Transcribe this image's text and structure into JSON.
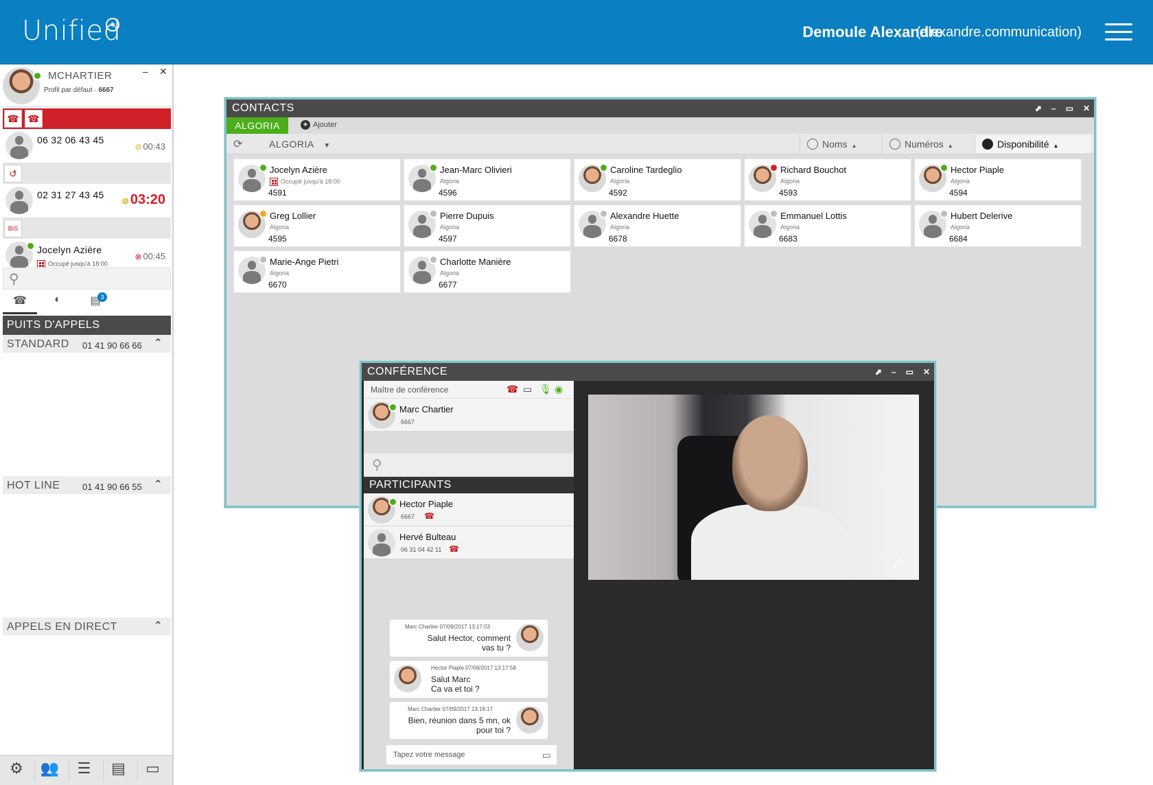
{
  "header": {
    "logo": "Unified",
    "user_name": "Demoule Alexandre",
    "user_id": "(alexandre.communication)"
  },
  "profile": {
    "name": "MCHARTIER",
    "profile_label": "Profil par défaut · ",
    "extension": "6667"
  },
  "calls": [
    {
      "number": "06 32 06 43 45",
      "timer": "00:43"
    },
    {
      "number": "02 31 27 43 45",
      "timer": "03:20"
    },
    {
      "number": "Jocelyn Azière",
      "status": "Occupé jusqu'à 18:00",
      "timer": "00:45"
    }
  ],
  "tabs_badge": "3",
  "left_section_title": "PUITS D'APPELS",
  "queues": [
    {
      "name": "STANDARD",
      "number": "01 41 90 66 66"
    },
    {
      "name": "HOT LINE",
      "number": "01 41 90 66 55"
    },
    {
      "name": "APPELS EN DIRECT",
      "number": ""
    }
  ],
  "contacts": {
    "title": "CONTACTS",
    "tab": "ALGORIA",
    "add_label": "Ajouter",
    "group_filter": "ALGORIA",
    "sort_names": "Noms",
    "sort_numbers": "Numéros",
    "sort_availability": "Disponibilité",
    "cards": [
      {
        "name": "Jocelyn Azière",
        "status": "Occupé jusqu'à 18:00",
        "ext": "4591",
        "presence": "green",
        "photo": false
      },
      {
        "name": "Jean-Marc Olivieri",
        "status": "Algoria",
        "ext": "4596",
        "presence": "green",
        "photo": false
      },
      {
        "name": "Caroline Tardeglio",
        "status": "Algoria",
        "ext": "4592",
        "presence": "green",
        "photo": true
      },
      {
        "name": "Richard Bouchot",
        "status": "Algoria",
        "ext": "4593",
        "presence": "red",
        "photo": true
      },
      {
        "name": "Hector Piaple",
        "status": "Algoria",
        "ext": "4594",
        "presence": "green",
        "photo": true
      },
      {
        "name": "Greg Lollier",
        "status": "Algoria",
        "ext": "4595",
        "presence": "orange",
        "photo": true
      },
      {
        "name": "Pierre Dupuis",
        "status": "Algoria",
        "ext": "4597",
        "presence": "grey",
        "photo": false
      },
      {
        "name": "Alexandre Huette",
        "status": "Algoria",
        "ext": "6678",
        "presence": "grey",
        "photo": false
      },
      {
        "name": "Emmanuel Lottis",
        "status": "Algoria",
        "ext": "6683",
        "presence": "grey",
        "photo": false
      },
      {
        "name": "Hubert Delerive",
        "status": "Algoria",
        "ext": "6684",
        "presence": "grey",
        "photo": false
      },
      {
        "name": "Marie-Ange Pietri",
        "status": "Algoria",
        "ext": "6670",
        "presence": "grey",
        "photo": false
      },
      {
        "name": "Charlotte Manière",
        "status": "Algoria",
        "ext": "6677",
        "presence": "grey",
        "photo": false
      }
    ]
  },
  "conference": {
    "title": "CONFÉRENCE",
    "master_label": "Maître de conférence",
    "master": {
      "name": "Marc Chartier",
      "ext": "6667"
    },
    "participants_title": "PARTICIPANTS",
    "participants": [
      {
        "name": "Hector Piaple",
        "ext": "6667"
      },
      {
        "name": "Hervé Bulteau",
        "ext": "06 31 04 42 11"
      }
    ],
    "messages": [
      {
        "meta": "Marc Chartier 07/09/2017 13:17:03",
        "line1": "Salut Hector, comment",
        "line2": "vas tu ?"
      },
      {
        "meta": "Hector Piaple 07/09/2017 13:17:58",
        "line1": "Salut Marc",
        "line2": "Ca va et toi ?"
      },
      {
        "meta": "Marc Chartier 07/09/2017 13:18:17",
        "line1": "Bien, réunion dans 5 mn, ok",
        "line2": "pour toi ?"
      }
    ],
    "input_placeholder": "Tapez votre message"
  },
  "colors": {
    "header_blue": "#0a7fc1",
    "accent_green": "#4cae1a",
    "alert_red": "#d0202a",
    "window_border": "#7fc1c9"
  }
}
